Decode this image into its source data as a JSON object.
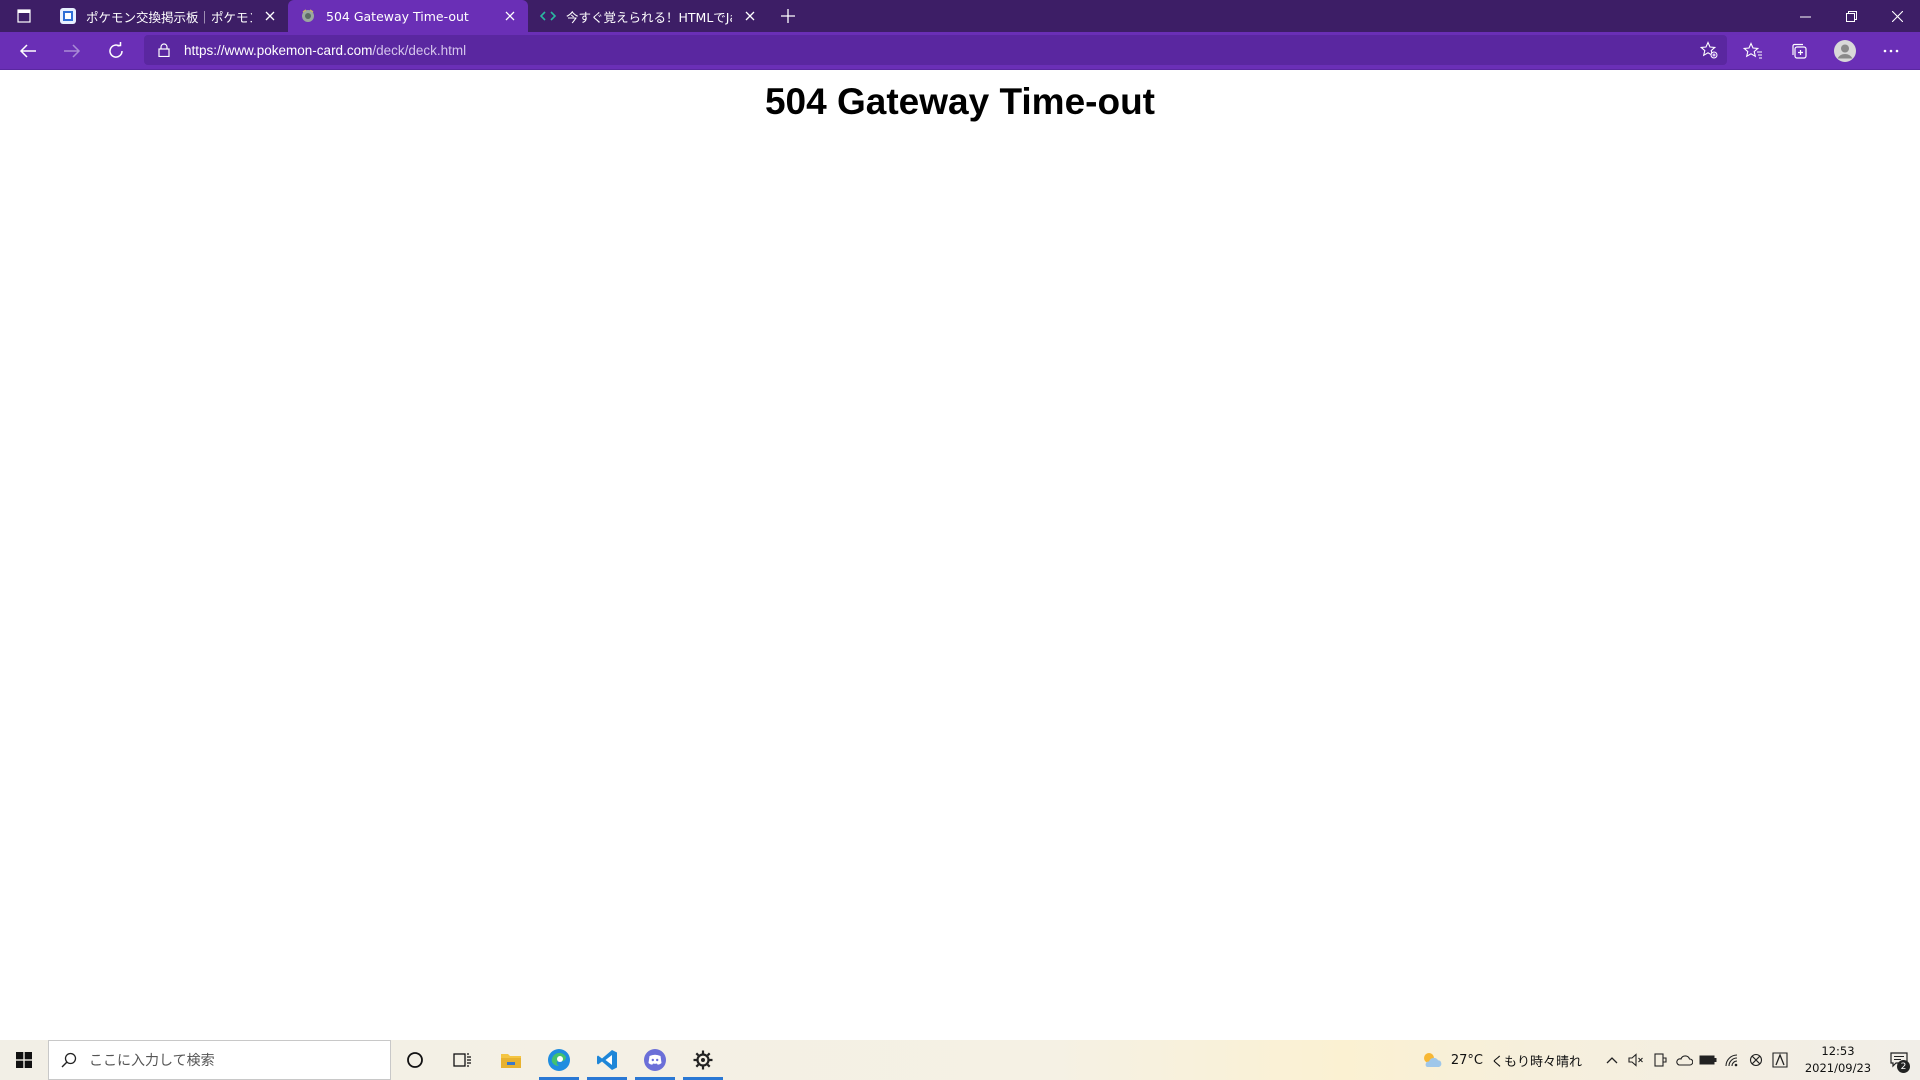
{
  "tabs": [
    {
      "title": "ポケモン交換掲示板｜ポケモントレーナー",
      "active": false,
      "favicon": "pokemon-board-favicon"
    },
    {
      "title": "504 Gateway Time-out",
      "active": true,
      "favicon": "pokemon-card-favicon"
    },
    {
      "title": "今すぐ覚えられる！HTMLでJavaScript",
      "active": false,
      "favicon": "code-favicon"
    }
  ],
  "address_bar": {
    "url_host": "https://www.pokemon-card.com",
    "url_path": "/deck/deck.html"
  },
  "page": {
    "heading": "504 Gateway Time-out"
  },
  "taskbar": {
    "search_placeholder": "ここに入力して検索",
    "weather_temp": "27°C",
    "weather_text": "くもり時々晴れ",
    "time": "12:53",
    "date": "2021/09/23",
    "notification_count": "2"
  },
  "colors": {
    "tabbar_bg": "#3d1e66",
    "toolbar_bg": "#6a2fb6",
    "address_bg": "#5a27a0"
  }
}
